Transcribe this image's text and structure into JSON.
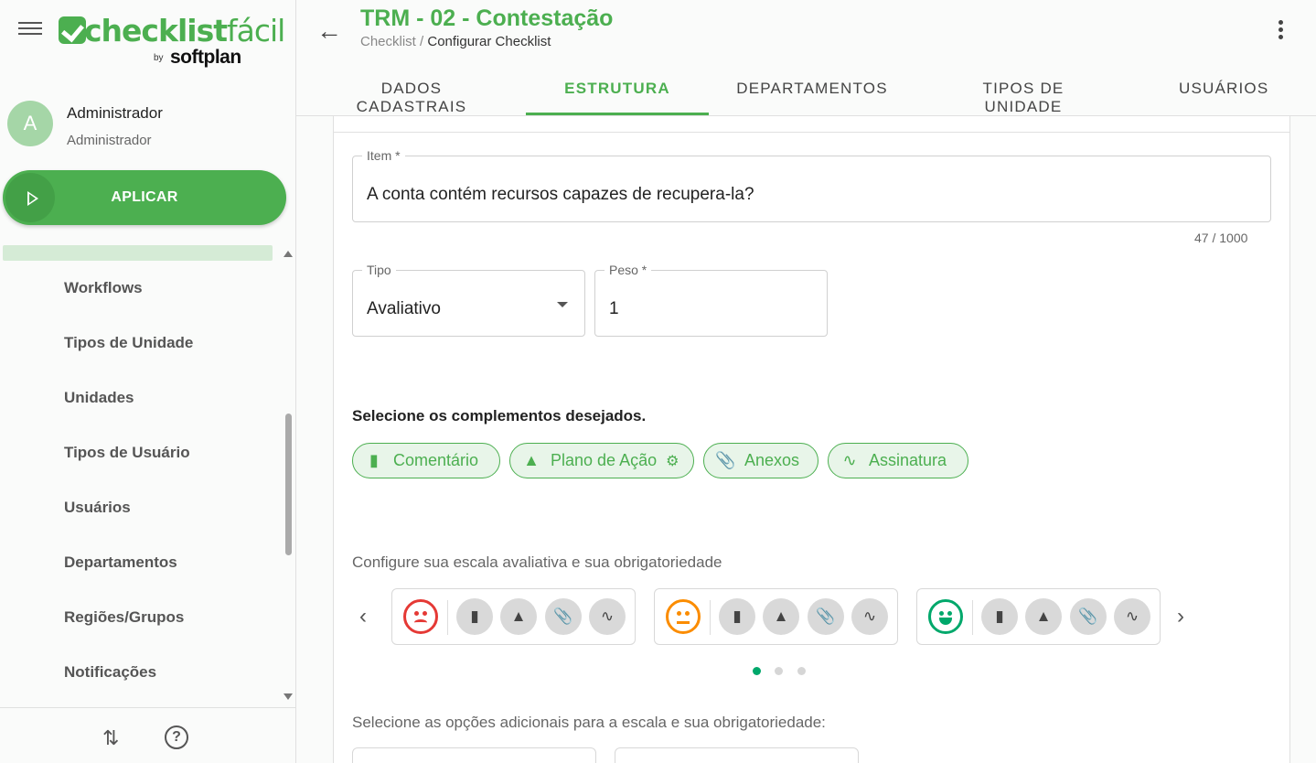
{
  "app": {
    "logo_text_bold": "checklist",
    "logo_text_light": "fácil",
    "logo_by": "by",
    "logo_company": "softplan"
  },
  "profile": {
    "initial": "A",
    "name": "Administrador",
    "role": "Administrador"
  },
  "sidebar": {
    "apply_label": "APLICAR",
    "items": [
      {
        "label": "Workflows"
      },
      {
        "label": "Tipos de Unidade"
      },
      {
        "label": "Unidades"
      },
      {
        "label": "Tipos de Usuário"
      },
      {
        "label": "Usuários"
      },
      {
        "label": "Departamentos"
      },
      {
        "label": "Regiões/Grupos"
      },
      {
        "label": "Notificações"
      }
    ],
    "footer": {
      "swap_glyph": "⇅",
      "help_glyph": "?"
    }
  },
  "header": {
    "title": "TRM - 02 - Contestação",
    "breadcrumb_root": "Checklist /",
    "breadcrumb_current": "Configurar Checklist",
    "tabs": [
      {
        "label": "DADOS CADASTRAIS",
        "active": false
      },
      {
        "label": "ESTRUTURA",
        "active": true
      },
      {
        "label": "DEPARTAMENTOS",
        "active": false
      },
      {
        "label": "TIPOS DE UNIDADE",
        "active": false
      },
      {
        "label": "USUÁRIOS",
        "active": false
      }
    ]
  },
  "form": {
    "item_label": "Item *",
    "item_value": "A conta contém recursos capazes de recupera-la?",
    "item_counter": "47 / 1000",
    "tipo_label": "Tipo",
    "tipo_value": "Avaliativo",
    "peso_label": "Peso *",
    "peso_value": "1"
  },
  "complements": {
    "title": "Selecione os complementos desejados.",
    "chips": [
      {
        "label": "Comentário",
        "icon": "comment-icon"
      },
      {
        "label": "Plano de Ação",
        "icon": "warning-icon"
      },
      {
        "label": "Anexos",
        "icon": "attachment-icon"
      },
      {
        "label": "Assinatura",
        "icon": "signature-icon"
      }
    ]
  },
  "scale": {
    "title": "Configure sua escala avaliativa e sua obrigatoriedade",
    "cards": [
      {
        "face": "sad-face-icon",
        "color": "#e53935"
      },
      {
        "face": "neutral-face-icon",
        "color": "#fb8c00"
      },
      {
        "face": "happy-face-icon",
        "color": "#00a86b"
      }
    ],
    "page_count": 3,
    "active_page": 0
  },
  "additional": {
    "title": "Selecione as opções adicionais para a escala e sua obrigatoriedade:"
  },
  "colors": {
    "primary": "#4caf50",
    "chip_bg": "#e8f5e9",
    "dot_active": "#00a86b"
  }
}
